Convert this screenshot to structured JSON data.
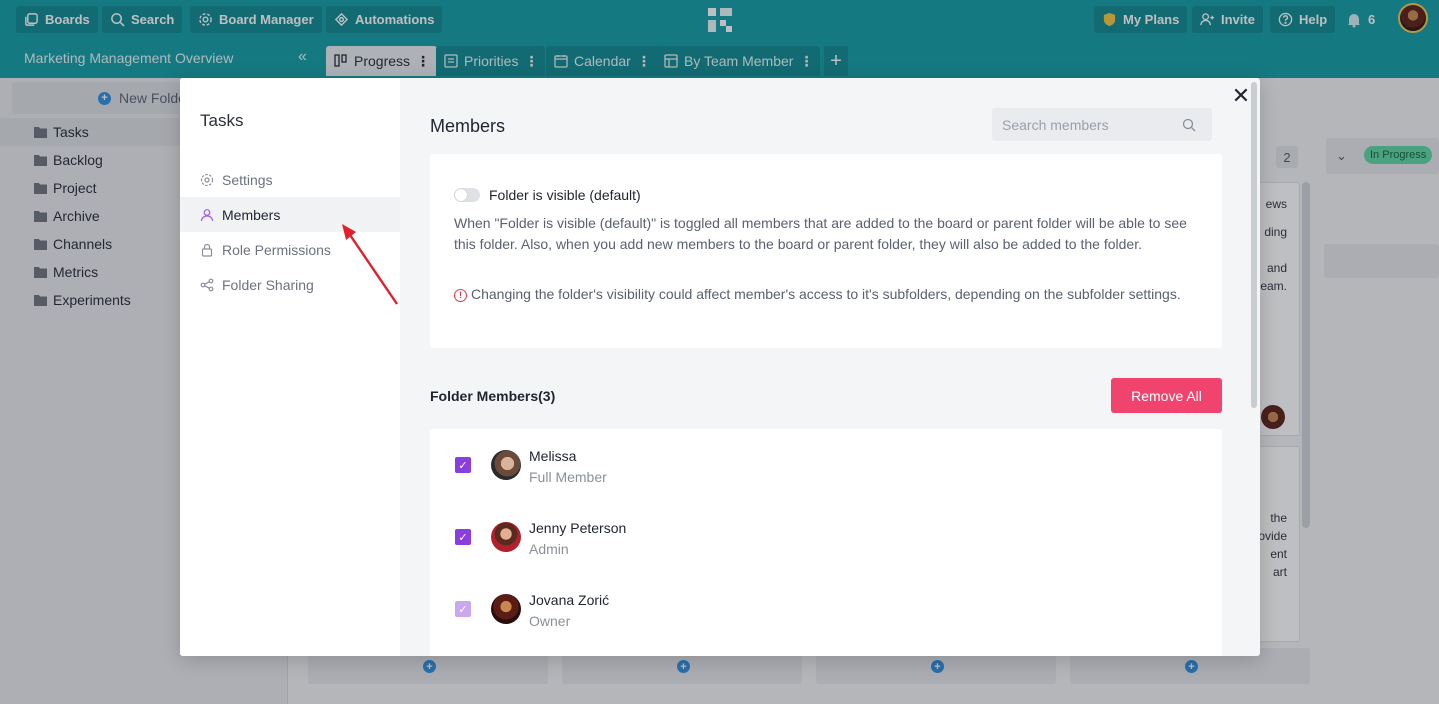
{
  "topnav": {
    "boards": "Boards",
    "search": "Search",
    "board_manager": "Board Manager",
    "automations": "Automations",
    "my_plans": "My Plans",
    "invite": "Invite",
    "help": "Help",
    "notifications_count": "6"
  },
  "board": {
    "title": "Marketing Management Overview",
    "tabs": [
      {
        "label": "Progress"
      },
      {
        "label": "Priorities"
      },
      {
        "label": "Calendar"
      },
      {
        "label": "By Team Member"
      }
    ]
  },
  "sidebar": {
    "new_folder": "New Folder",
    "folders": [
      "Tasks",
      "Backlog",
      "Project",
      "Archive",
      "Channels",
      "Metrics",
      "Experiments"
    ]
  },
  "background": {
    "column_count": "2",
    "status_badge": "In Progress",
    "card1_lines": [
      "ews",
      "ding",
      "",
      "and",
      "eam."
    ],
    "card2_lines": [
      "the",
      "ovide",
      "ent",
      "art"
    ]
  },
  "modal": {
    "nav_title": "Tasks",
    "nav_items": [
      "Settings",
      "Members",
      "Role Permissions",
      "Folder Sharing"
    ],
    "members_title": "Members",
    "search_placeholder": "Search members",
    "visibility_label": "Folder is visible (default)",
    "visibility_description": "When \"Folder is visible (default)\" is toggled all members that are added to the board or parent folder will be able to see this folder. Also, when you add new members to the board or parent folder, they will also be added to the folder.",
    "visibility_warning": "Changing the folder's visibility could affect member's access to it's subfolders, depending on the subfolder settings.",
    "folder_members_title": "Folder Members(3)",
    "remove_all": "Remove All",
    "members": [
      {
        "name": "Melissa",
        "role": "Full Member"
      },
      {
        "name": "Jenny Peterson",
        "role": "Admin"
      },
      {
        "name": "Jovana Zorić",
        "role": "Owner"
      }
    ]
  },
  "colors": {
    "brand_teal": "#0d9ba3",
    "checkbox_purple": "#8a3ee0",
    "danger_pink": "#f0446e",
    "arrow_red": "#e0202a"
  }
}
